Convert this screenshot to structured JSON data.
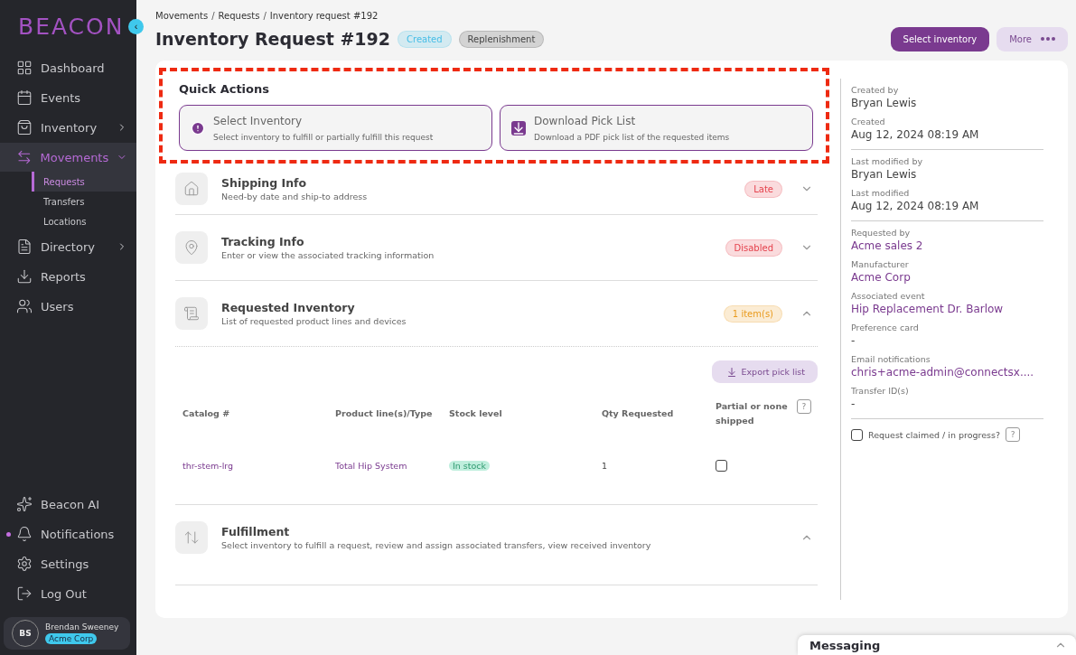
{
  "sidebar": {
    "logo": "BEACON",
    "collapse_button": "‹",
    "items": [
      {
        "label": "Dashboard",
        "selected": false,
        "expandable": false
      },
      {
        "label": "Events",
        "selected": false,
        "expandable": false
      },
      {
        "label": "Inventory",
        "selected": false,
        "expandable": true,
        "expanded": false
      },
      {
        "label": "Movements",
        "selected": true,
        "expandable": true,
        "expanded": true,
        "children": [
          {
            "label": "Requests",
            "selected": true
          },
          {
            "label": "Transfers",
            "selected": false
          },
          {
            "label": "Locations",
            "selected": false
          }
        ]
      },
      {
        "label": "Directory",
        "selected": false,
        "expandable": true,
        "expanded": false
      },
      {
        "label": "Reports",
        "selected": false,
        "expandable": false
      },
      {
        "label": "Users",
        "selected": false,
        "expandable": false
      }
    ],
    "bottom_items": [
      {
        "label": "Beacon AI",
        "unread": false
      },
      {
        "label": "Notifications",
        "unread": true
      },
      {
        "label": "Settings",
        "unread": false
      },
      {
        "label": "Log Out",
        "unread": false
      }
    ],
    "user": {
      "initials": "BS",
      "name": "Brendan Sweeney",
      "org": "Acme Corp"
    }
  },
  "breadcrumb": [
    "Movements",
    "Requests",
    "Inventory request #192"
  ],
  "breadcrumb_separator": "/",
  "title": "Inventory Request #192",
  "title_badges": [
    {
      "label": "Created",
      "color": "#46bde6"
    },
    {
      "label": "Replenishment",
      "color": "#444444"
    }
  ],
  "header_buttons": [
    {
      "label": "Select inventory",
      "kind": "primary"
    },
    {
      "label": "More",
      "kind": "more"
    }
  ],
  "quick_actions": {
    "title": "Quick Actions",
    "highlighted": true,
    "actions": [
      {
        "title": "Select Inventory",
        "subtitle": "Select inventory to fulfill or partially fulfill this request"
      },
      {
        "title": "Download Pick List",
        "subtitle": "Download a PDF pick list of the requested items"
      }
    ]
  },
  "sections": [
    {
      "title": "Shipping Info",
      "subtitle": "Need-by date and ship-to address",
      "badge": {
        "label": "Late",
        "color": "#e5424d"
      },
      "expanded": false
    },
    {
      "title": "Tracking Info",
      "subtitle": "Enter or view the associated tracking information",
      "badge": {
        "label": "Disabled",
        "color": "#e5424d"
      },
      "expanded": false
    },
    {
      "title": "Requested Inventory",
      "subtitle": "List of requested product lines and devices",
      "badge": {
        "label": "1 item(s)",
        "color": "#e99a1c"
      },
      "expanded": true,
      "export_button": "Export pick list",
      "table": {
        "columns": [
          "Catalog #",
          "Product line(s)/Type",
          "Stock level",
          "Qty Requested",
          "Partial or none shipped"
        ],
        "rows": [
          {
            "catalog": "thr-stem-lrg",
            "product_line": "Total Hip System",
            "stock": "In stock",
            "qty": "1",
            "partial_checked": false
          }
        ]
      }
    },
    {
      "title": "Fulfillment",
      "subtitle": "Select inventory to fulfill a request, review and assign associated transfers, view received inventory",
      "expanded": true
    }
  ],
  "details": [
    {
      "label": "Created by",
      "value": "Bryan Lewis",
      "link": false,
      "divider_after": false
    },
    {
      "label": "Created",
      "value": "Aug 12, 2024 08:19 AM",
      "link": false,
      "divider_after": true
    },
    {
      "label": "Last modified by",
      "value": "Bryan Lewis",
      "link": false,
      "divider_after": false
    },
    {
      "label": "Last modified",
      "value": "Aug 12, 2024 08:19 AM",
      "link": false,
      "divider_after": true
    },
    {
      "label": "Requested by",
      "value": "Acme sales 2",
      "link": true,
      "divider_after": false
    },
    {
      "label": "Manufacturer",
      "value": "Acme Corp",
      "link": true,
      "divider_after": false
    },
    {
      "label": "Associated event",
      "value": "Hip Replacement Dr. Barlow",
      "link": true,
      "divider_after": false
    },
    {
      "label": "Preference card",
      "value": "-",
      "link": false,
      "divider_after": false
    },
    {
      "label": "Email notifications",
      "value": "chris+acme-admin@connectsx....",
      "link": true,
      "divider_after": false
    },
    {
      "label": "Transfer ID(s)",
      "value": "-",
      "link": false,
      "divider_after": true
    }
  ],
  "claimed": {
    "label": "Request claimed / in progress?",
    "checked": false,
    "help": "?"
  },
  "messaging": {
    "title": "Messaging",
    "expanded": false
  }
}
